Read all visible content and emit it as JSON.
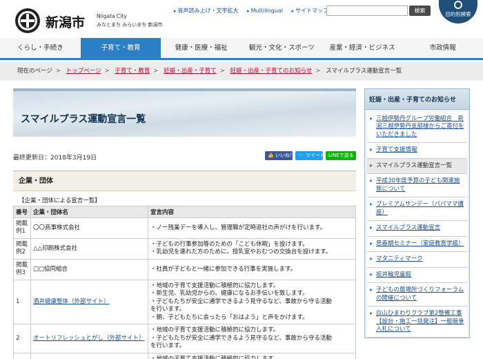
{
  "header": {
    "logo_name": "新潟市",
    "logo_en": "Niigata City",
    "logo_sub": "みなとまち みらいまち 新潟市",
    "util_links": [
      "音声読み上げ・文字拡大",
      "Multilingual",
      "サイトマップ"
    ],
    "search_placeholder": "",
    "search_button": "検索",
    "guide_button": "目的別検索"
  },
  "nav": {
    "items": [
      "くらし・手続き",
      "子育て・教育",
      "健康・医療・福祉",
      "観光・文化・スポーツ",
      "産業・経済・ビジネス",
      "市政情報"
    ],
    "active_index": 1
  },
  "breadcrumb": {
    "label": "現在のページ",
    "links": [
      "トップページ",
      "子育て・教育",
      "妊娠・出産・子育て",
      "妊娠・出産・子育てのお知らせ"
    ],
    "current": "スマイルプラス運動宣言一覧"
  },
  "main": {
    "title": "スマイルプラス運動宣言一覧",
    "updated": "最終更新日：2018年3月19日",
    "share": {
      "facebook": "👍 いいね！",
      "twitter": "🐦 ツイート",
      "line": "LINEで送る"
    },
    "section": "企業・団体",
    "caption": "【企業・団体による宣言一覧】",
    "table": {
      "headers": [
        "番号",
        "企業・団体名",
        "宣言内容"
      ],
      "rows": [
        {
          "num": "掲載例1",
          "name": "〇〇商事株式会社",
          "link": false,
          "content": [
            "・ノー残業デーを導入し、管理職が定時退社の声がけを行います。"
          ]
        },
        {
          "num": "掲載例2",
          "name": "△△印刷株式会社",
          "link": false,
          "content": [
            "・子どもの行事参加等のための「こども休暇」を設けます。",
            "・乳幼児を連れた方のために、授乳室やおむつの交換台を設けます。"
          ]
        },
        {
          "num": "掲載例3",
          "name": "□□協同組合",
          "link": false,
          "content": [
            "・社員が子どもと一緒に参加できる行事を実施します。"
          ]
        },
        {
          "num": "1",
          "name": "酒井健康整体（外部サイト）",
          "link": true,
          "content": [
            "・地域の子育て支援活動に積極的に協力します。",
            "・新生児、乳幼児からの、健康になるお手伝いを致します。",
            "・子どもたちが安全に通学できるよう見守るなど、事故から守る活動",
            "を行います。",
            "・朝、子どもたちに会ったら「おはよう」と声をかけます。"
          ]
        },
        {
          "num": "2",
          "name": "オートリフレッシュとがし（外部サイト）",
          "link": true,
          "content": [
            "・地域の子育て支援活動に積極的に協力します。",
            "・子どもたちが安全に通学できるよう見守るなど、事故から守る活動",
            "を行います。"
          ]
        },
        {
          "num": "",
          "name": "",
          "link": false,
          "content": [
            "・地域の子育て支援活動に積極的に協力します。"
          ]
        }
      ]
    }
  },
  "sidebar": {
    "title": "妊娠・出産・子育てのお知らせ",
    "items": [
      {
        "label": "三越伊勢丹グループ労働組合　新潟三越伊勢丹支部様からご寄付をいただきました",
        "current": false
      },
      {
        "label": "子育て支援情報",
        "current": false
      },
      {
        "label": "スマイルプラス運動宣言一覧",
        "current": true
      },
      {
        "label": "平成30年度予算の子ども関連施策について",
        "current": false
      },
      {
        "label": "プレミアムサンデー（パパママ講座）",
        "current": false
      },
      {
        "label": "スマイルプラス運動宣言",
        "current": false
      },
      {
        "label": "思春期セミナー（家庭教育学級）",
        "current": false
      },
      {
        "label": "マタニティマーク",
        "current": false
      },
      {
        "label": "坂井輪児童館",
        "current": false
      },
      {
        "label": "子どもの居場所づくりフォーラムの開催について",
        "current": false
      },
      {
        "label": "白山ひまわりクラブ第2整備工事【設計・施工一括発注】一般競争入札について",
        "current": false
      }
    ]
  }
}
